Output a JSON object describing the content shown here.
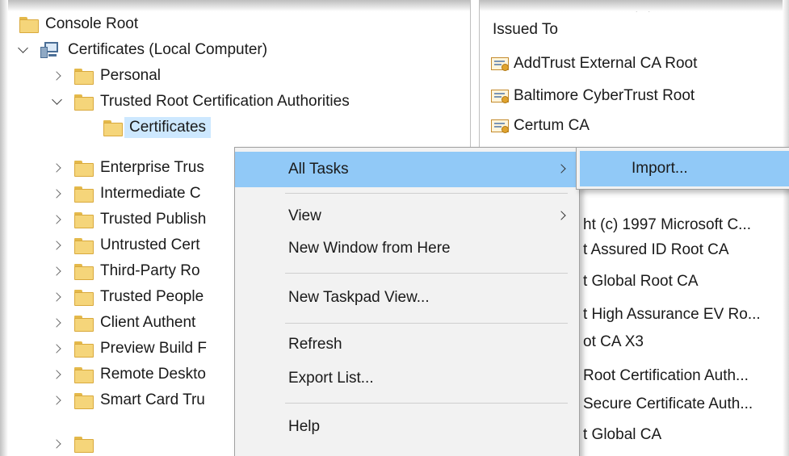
{
  "tree": {
    "root": "Console Root",
    "computer": "Certificates (Local Computer)",
    "items": [
      {
        "label": "Personal"
      },
      {
        "label": "Trusted Root Certification Authorities"
      },
      {
        "label": "Certificates"
      },
      {
        "label": "Enterprise Trus"
      },
      {
        "label": "Intermediate C"
      },
      {
        "label": "Trusted Publish"
      },
      {
        "label": "Untrusted Cert"
      },
      {
        "label": "Third-Party Ro"
      },
      {
        "label": "Trusted People"
      },
      {
        "label": "Client Authent"
      },
      {
        "label": "Preview Build F"
      },
      {
        "label": "Remote Deskto"
      },
      {
        "label": "Smart Card Tru"
      }
    ]
  },
  "list": {
    "column_header": "Issued To",
    "rows": [
      "AddTrust External CA Root",
      "Baltimore CyberTrust Root",
      "Certum CA",
      "ht (c) 1997 Microsoft C...",
      "t Assured ID Root CA",
      "t Global Root CA",
      "t High Assurance EV Ro...",
      "ot CA X3",
      "Root Certification Auth...",
      "Secure Certificate Auth...",
      "t Global CA"
    ]
  },
  "context_menu": {
    "items": [
      "All Tasks",
      "View",
      "New Window from Here",
      "New Taskpad View...",
      "Refresh",
      "Export List...",
      "Help"
    ]
  },
  "submenu": {
    "items": [
      "Import..."
    ]
  },
  "icons": {
    "folder": "folder-icon",
    "computer": "computer-icon",
    "certificate": "certificate-icon",
    "expander_collapsed": "chevron-right-icon",
    "expander_expanded": "chevron-down-icon",
    "submenu_arrow": "chevron-right-icon",
    "sort": "sort-up-icon"
  },
  "colors": {
    "menu_highlight": "#91c9f7",
    "tree_selection": "#cde8ff",
    "menu_background": "#f2f2f2"
  }
}
